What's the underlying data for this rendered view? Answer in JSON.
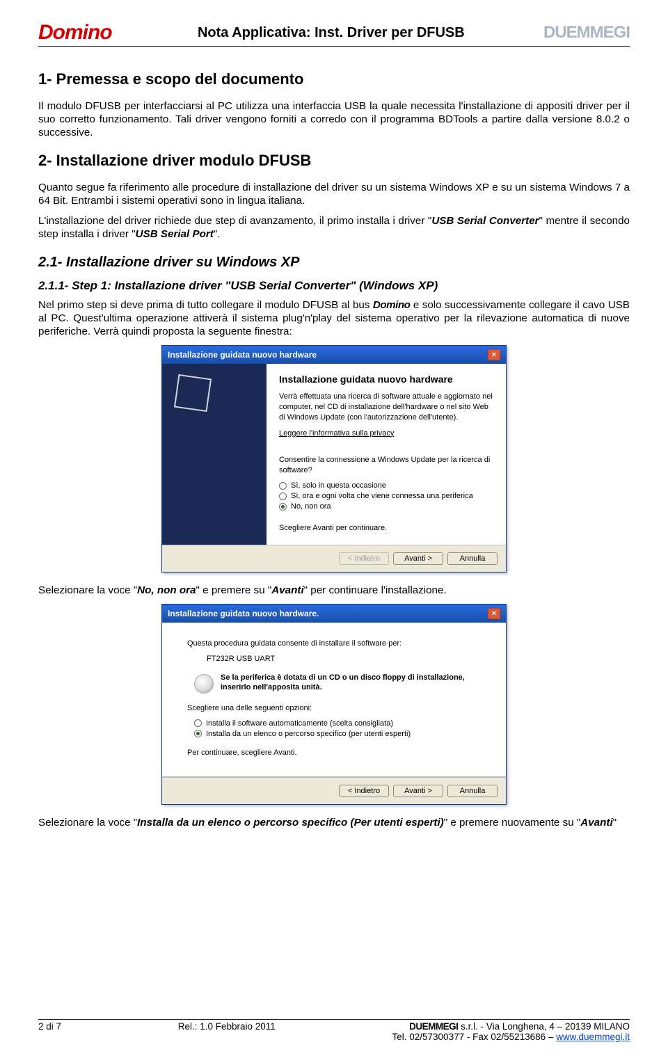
{
  "header": {
    "logo_left": "Domino",
    "title": "Nota Applicativa: Inst. Driver per DFUSB",
    "logo_right": "DUEMMEGI"
  },
  "section1": {
    "title": "1- Premessa e scopo del documento",
    "p1": "Il modulo DFUSB per interfacciarsi al PC utilizza una interfaccia USB la quale necessita l'installazione di appositi driver per il suo corretto funzionamento. Tali driver vengono forniti a corredo con il programma BDTools a partire dalla versione 8.0.2 o successive."
  },
  "section2": {
    "title": "2- Installazione driver modulo DFUSB",
    "p1a": "Quanto segue fa riferimento alle procedure di installazione del driver su un sistema Windows XP e su un sistema Windows 7 a 64 Bit. Entrambi i sistemi operativi sono in lingua italiana.",
    "p1b_a": "L'installazione del driver richiede due step di avanzamento, il primo installa i driver \"",
    "p1b_b": "USB Serial Converter",
    "p1b_c": "\" mentre il secondo step installa i driver \"",
    "p1b_d": "USB Serial Port",
    "p1b_e": "\"."
  },
  "section21": {
    "title": "2.1- Installazione driver su Windows XP"
  },
  "section211": {
    "title": "2.1.1- Step 1: Installazione driver \"USB Serial Converter\" (Windows XP)",
    "p1_a": "Nel primo step si deve prima di tutto collegare il modulo DFUSB al bus ",
    "p1_b": "Domino",
    "p1_c": " e solo successivamente collegare il cavo USB al PC. Quest'ultima operazione attiverà il sistema plug'n'play del sistema operativo per la rilevazione automatica di nuove periferiche. Verrà quindi proposta la seguente finestra:"
  },
  "wizard1": {
    "caption": "Installazione guidata nuovo hardware",
    "title": "Installazione guidata nuovo hardware",
    "desc": "Verrà effettuata una ricerca di software attuale e aggiornato nel computer, nel CD di installazione dell'hardware o nel sito Web di Windows Update (con l'autorizzazione dell'utente).",
    "privacy": "Leggere l'informativa sulla privacy",
    "q": "Consentire la connessione a Windows Update per la ricerca di software?",
    "opt1": "Sì, solo in questa occasione",
    "opt2": "Sì, ora e ogni volta che viene connessa una periferica",
    "opt3": "No, non ora",
    "cont": "Scegliere Avanti per continuare.",
    "btn_back": "< Indietro",
    "btn_next": "Avanti >",
    "btn_cancel": "Annulla"
  },
  "after1_a": "Selezionare la voce \"",
  "after1_b": "No, non ora",
  "after1_c": "\" e premere su \"",
  "after1_d": "Avanti",
  "after1_e": "\" per continuare l'installazione.",
  "wizard2": {
    "caption": "Installazione guidata nuovo hardware.",
    "banner": "Questa procedura guidata consente di installare il software per:",
    "device": "FT232R USB UART",
    "cd": "Se la periferica è dotata di un CD o un disco floppy di installazione, inserirlo nell'apposita unità.",
    "choose": "Scegliere una delle seguenti opzioni:",
    "opt1": "Installa il software automaticamente (scelta consigliata)",
    "opt2": "Installa da un elenco o percorso specifico (per utenti esperti)",
    "cont": "Per continuare, scegliere Avanti.",
    "btn_back": "< Indietro",
    "btn_next": "Avanti >",
    "btn_cancel": "Annulla"
  },
  "after2_a": "Selezionare la voce \"",
  "after2_b": "Installa da un elenco o percorso specifico (Per utenti esperti)",
  "after2_c": "\" e premere nuovamente su \"",
  "after2_d": "Avanti",
  "after2_e": "\"",
  "footer": {
    "page": "2 di 7",
    "rel": "Rel.: 1.0 Febbraio 2011",
    "company": "DUEMMEGI",
    "addr": " s.r.l. - Via Longhena, 4 – 20139 MILANO",
    "tel": "Tel. 02/57300377 - Fax 02/55213686 – ",
    "url": "www.duemmegi.it"
  }
}
